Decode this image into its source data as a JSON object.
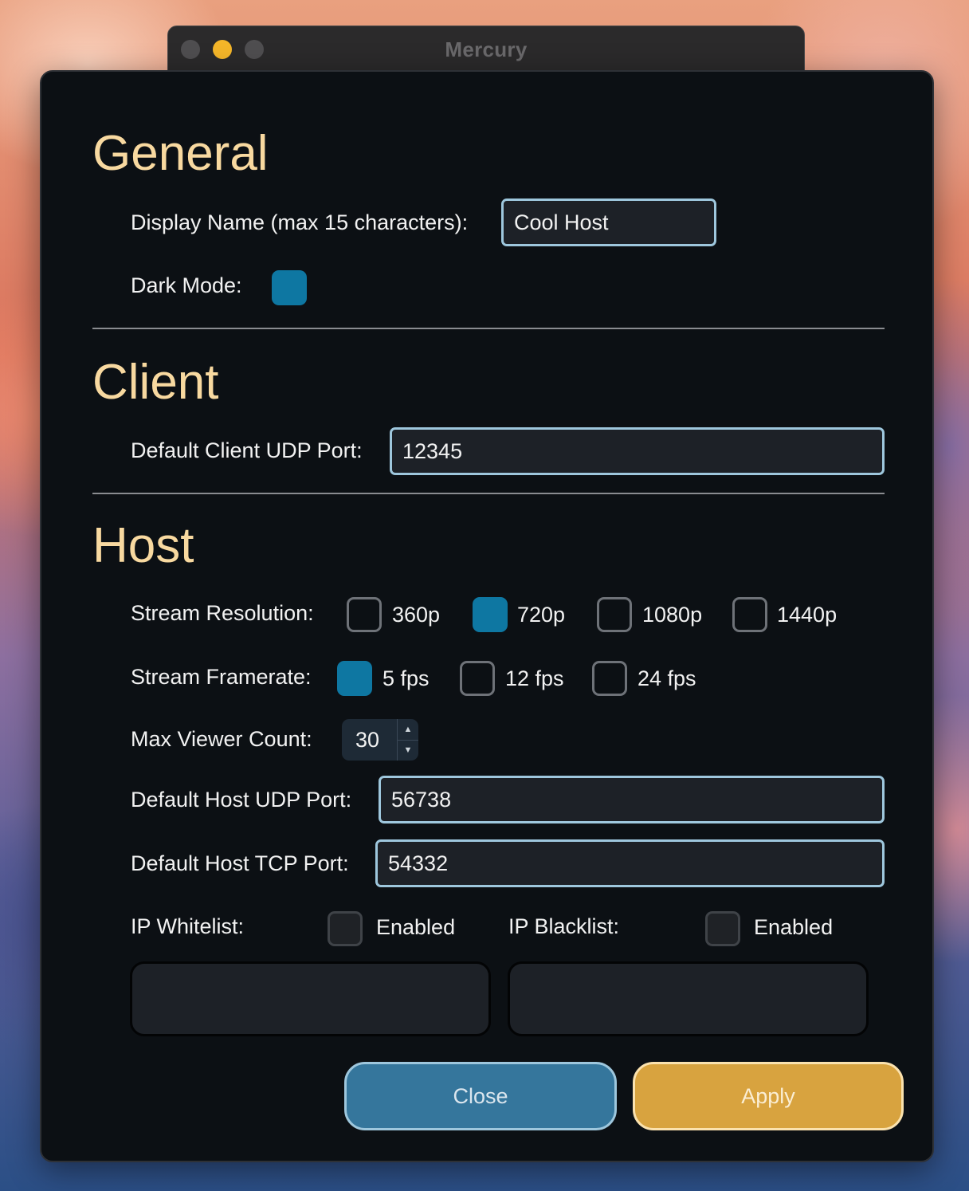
{
  "window": {
    "title": "Mercury"
  },
  "general": {
    "heading": "General",
    "display_name_label": "Display Name (max 15 characters):",
    "display_name_value": "Cool Host",
    "dark_mode_label": "Dark Mode:",
    "dark_mode_checked": true
  },
  "client": {
    "heading": "Client",
    "udp_port_label": "Default Client UDP Port:",
    "udp_port_value": "12345"
  },
  "host": {
    "heading": "Host",
    "resolution_label": "Stream Resolution:",
    "resolutions": [
      {
        "label": "360p",
        "checked": false
      },
      {
        "label": "720p",
        "checked": true
      },
      {
        "label": "1080p",
        "checked": false
      },
      {
        "label": "1440p",
        "checked": false
      }
    ],
    "framerate_label": "Stream Framerate:",
    "framerates": [
      {
        "label": "5 fps",
        "checked": true
      },
      {
        "label": "12 fps",
        "checked": false
      },
      {
        "label": "24 fps",
        "checked": false
      }
    ],
    "max_viewer_label": "Max Viewer Count:",
    "max_viewer_value": "30",
    "udp_port_label": "Default Host UDP Port:",
    "udp_port_value": "56738",
    "tcp_port_label": "Default Host TCP Port:",
    "tcp_port_value": "54332",
    "whitelist_label": "IP Whitelist:",
    "whitelist_enabled_label": "Enabled",
    "whitelist_enabled": false,
    "blacklist_label": "IP Blacklist:",
    "blacklist_enabled_label": "Enabled",
    "blacklist_enabled": false
  },
  "buttons": {
    "close_label": "Close",
    "apply_label": "Apply"
  },
  "colors": {
    "heading": "#f8d9a0",
    "checkbox_checked": "#0e77a2",
    "field_border": "#9ec7dd",
    "close_button": "#35769c",
    "apply_button": "#d8a33f",
    "dialog_background": "#0c1014"
  }
}
